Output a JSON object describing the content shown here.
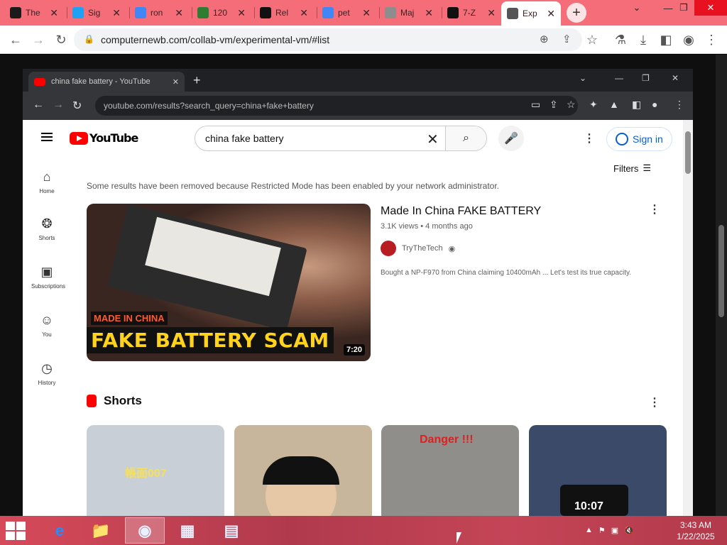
{
  "browser": {
    "tabs": [
      {
        "title": "The",
        "icon": "tbs-icon",
        "color": "#1b1b1b"
      },
      {
        "title": "Sig",
        "icon": "signal-icon",
        "color": "#1ea1f2"
      },
      {
        "title": "ron",
        "icon": "google-icon",
        "color": "#4285f4"
      },
      {
        "title": "120",
        "icon": "shield-icon",
        "color": "#2e7d32"
      },
      {
        "title": "Rel",
        "icon": "github-icon",
        "color": "#111111"
      },
      {
        "title": "pet",
        "icon": "google-icon",
        "color": "#4285f4"
      },
      {
        "title": "Maj",
        "icon": "map-icon",
        "color": "#8d8d8d"
      },
      {
        "title": "7-Z",
        "icon": "7zip-icon",
        "color": "#111111"
      },
      {
        "title": "Exp",
        "icon": "collabvm-icon",
        "color": "#555555"
      }
    ],
    "new_tab": "+",
    "url": "computernewb.com/collab-vm/experimental-vm/#list"
  },
  "vm_browser": {
    "tab_title": "china fake battery - YouTube",
    "url": "youtube.com/results?search_query=china+fake+battery"
  },
  "youtube": {
    "search_query": "china fake battery",
    "sign_in": "Sign in",
    "filters": "Filters",
    "sidebar": [
      {
        "label": "Home",
        "icon": "home-icon"
      },
      {
        "label": "Shorts",
        "icon": "shorts-icon"
      },
      {
        "label": "Subscriptions",
        "icon": "subscriptions-icon"
      },
      {
        "label": "You",
        "icon": "you-icon"
      },
      {
        "label": "History",
        "icon": "history-icon"
      }
    ],
    "notice": "Some results have been removed because Restricted Mode has been enabled by your network administrator.",
    "video": {
      "title": "Made In China FAKE BATTERY",
      "meta": "3.1K views • 4 months ago",
      "channel": "TryTheTech",
      "description": "Bought a NP-F970 from China claiming 10400mAh ... Let's test its true capacity.",
      "thumb_badge": "MADE IN CHINA",
      "thumb_text": "FAKE BATTERY SCAM",
      "duration": "7:20"
    },
    "shorts_title": "Shorts",
    "shorts": [
      {
        "overlay": "帳面007",
        "bg": "#c9cfd6"
      },
      {
        "overlay": "",
        "bg": "#c7b59c"
      },
      {
        "overlay": "Danger !!!",
        "bg": "#8f8e8a"
      },
      {
        "overlay": "10:07",
        "bg": "#3c4a6a"
      }
    ]
  },
  "taskbar": {
    "apps": [
      {
        "name": "internet-explorer-icon",
        "glyph": "e"
      },
      {
        "name": "file-explorer-icon",
        "glyph": "📁"
      },
      {
        "name": "chrome-icon",
        "glyph": "◉"
      },
      {
        "name": "control-panel-icon",
        "glyph": "▦"
      },
      {
        "name": "notepad-icon",
        "glyph": "▤"
      }
    ],
    "time": "3:43 AM",
    "date": "1/22/2025"
  },
  "colors": {
    "tab_strip": "#f56d78",
    "taskbar": "#c44556",
    "youtube_red": "#ff0000"
  }
}
